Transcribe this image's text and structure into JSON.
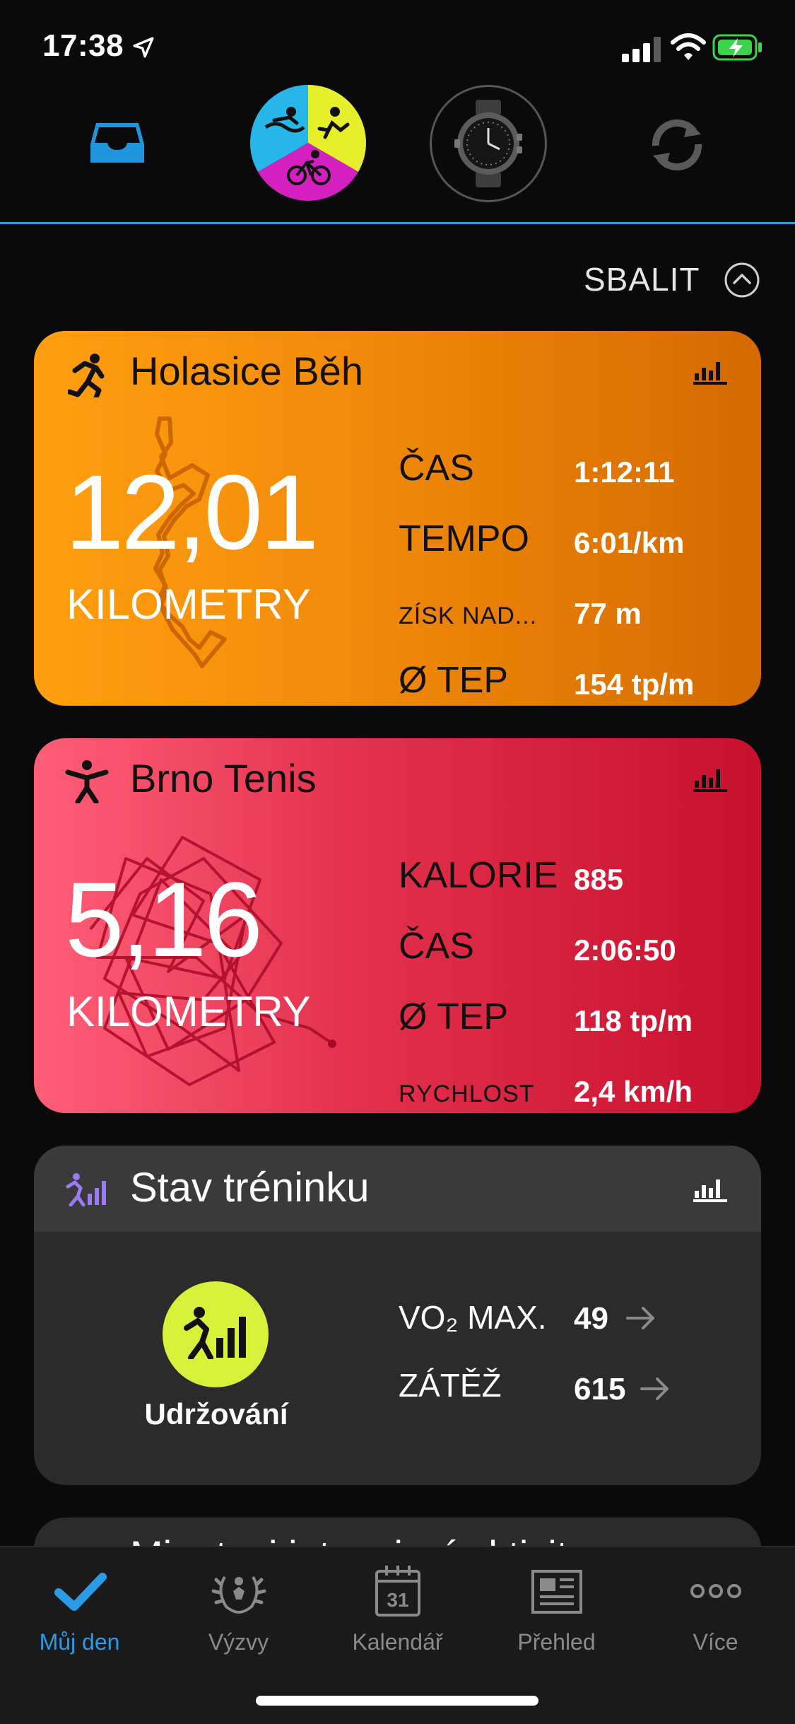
{
  "status_bar": {
    "time": "17:38"
  },
  "collapse": {
    "label": "SBALIT"
  },
  "activities": [
    {
      "title": "Holasice Běh",
      "distance": "12,01",
      "unit": "KILOMETRY",
      "stats": [
        {
          "label": "ČAS",
          "value": "1:12:11"
        },
        {
          "label": "TEMPO",
          "value": "6:01/km"
        },
        {
          "label": "ZÍSK NAD...",
          "value": "77 m"
        },
        {
          "label": "Ø TEP",
          "value": "154 tp/m"
        }
      ],
      "color": "#f18a0a"
    },
    {
      "title": "Brno Tenis",
      "distance": "5,16",
      "unit": "KILOMETRY",
      "stats": [
        {
          "label": "KALORIE",
          "value": "885"
        },
        {
          "label": "ČAS",
          "value": "2:06:50"
        },
        {
          "label": "Ø TEP",
          "value": "118 tp/m"
        },
        {
          "label": "RYCHLOST",
          "value": "2,4 km/h"
        }
      ],
      "color": "#e2304d"
    }
  ],
  "training": {
    "title": "Stav tréninku",
    "status": "Udržování",
    "stats": [
      {
        "label": "VO₂ MAX.",
        "value": "49"
      },
      {
        "label": "ZÁTĚŽ",
        "value": "615"
      }
    ],
    "accent": "#d7f03a"
  },
  "next_card": {
    "title_partial": "Minutovi intenzivní aktivity"
  },
  "tabs": [
    {
      "label": "Můj den",
      "icon": "checkmark-icon",
      "active": true
    },
    {
      "label": "Výzvy",
      "icon": "laurel-icon",
      "active": false
    },
    {
      "label": "Kalendář",
      "icon": "calendar-icon",
      "active": false
    },
    {
      "label": "Přehled",
      "icon": "newspaper-icon",
      "active": false
    },
    {
      "label": "Více",
      "icon": "more-icon",
      "active": false
    }
  ],
  "calendar_day": "31",
  "colors": {
    "accent": "#2b9be6",
    "header_line": "#2f9fe0"
  }
}
